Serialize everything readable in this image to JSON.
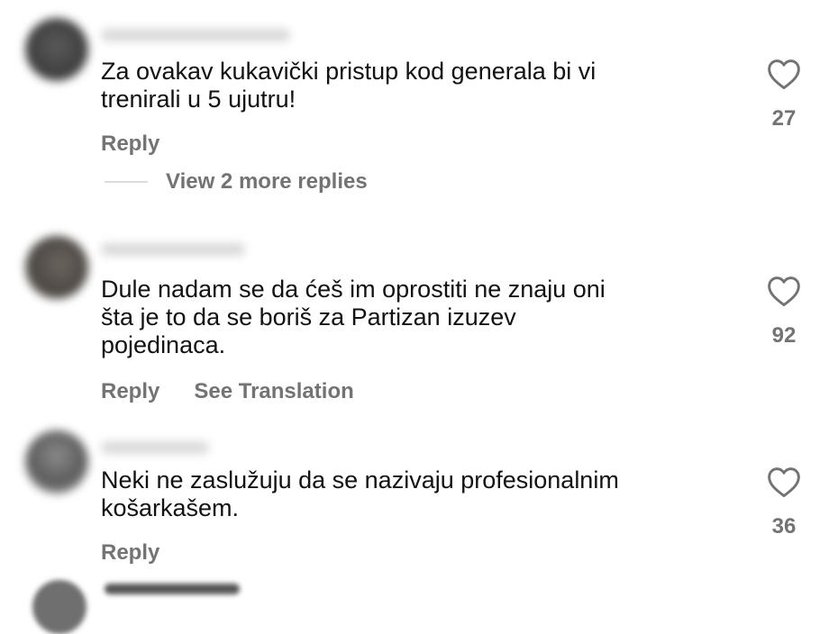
{
  "comments": [
    {
      "text": "Za ovakav kukavički pristup kod generala bi vi\ntrenirali u 5 ujutru!",
      "likes": "27",
      "actions": [
        "Reply"
      ],
      "view_replies": "View 2 more replies"
    },
    {
      "text": "Dule nadam se da ćeš im oprostiti ne znaju oni\nšta je to da se boriš za Partizan izuzev\npojedinaca.",
      "likes": "92",
      "actions": [
        "Reply",
        "See Translation"
      ]
    },
    {
      "text": "Neki ne zaslužuju da se nazivaju profesionalnim\nkošarkašem.",
      "likes": "36",
      "actions": [
        "Reply"
      ]
    }
  ],
  "icons": {
    "like": "heart-outline-icon"
  },
  "colors": {
    "text": "#121212",
    "secondary": "#737373",
    "divider": "#dbdbdb"
  }
}
